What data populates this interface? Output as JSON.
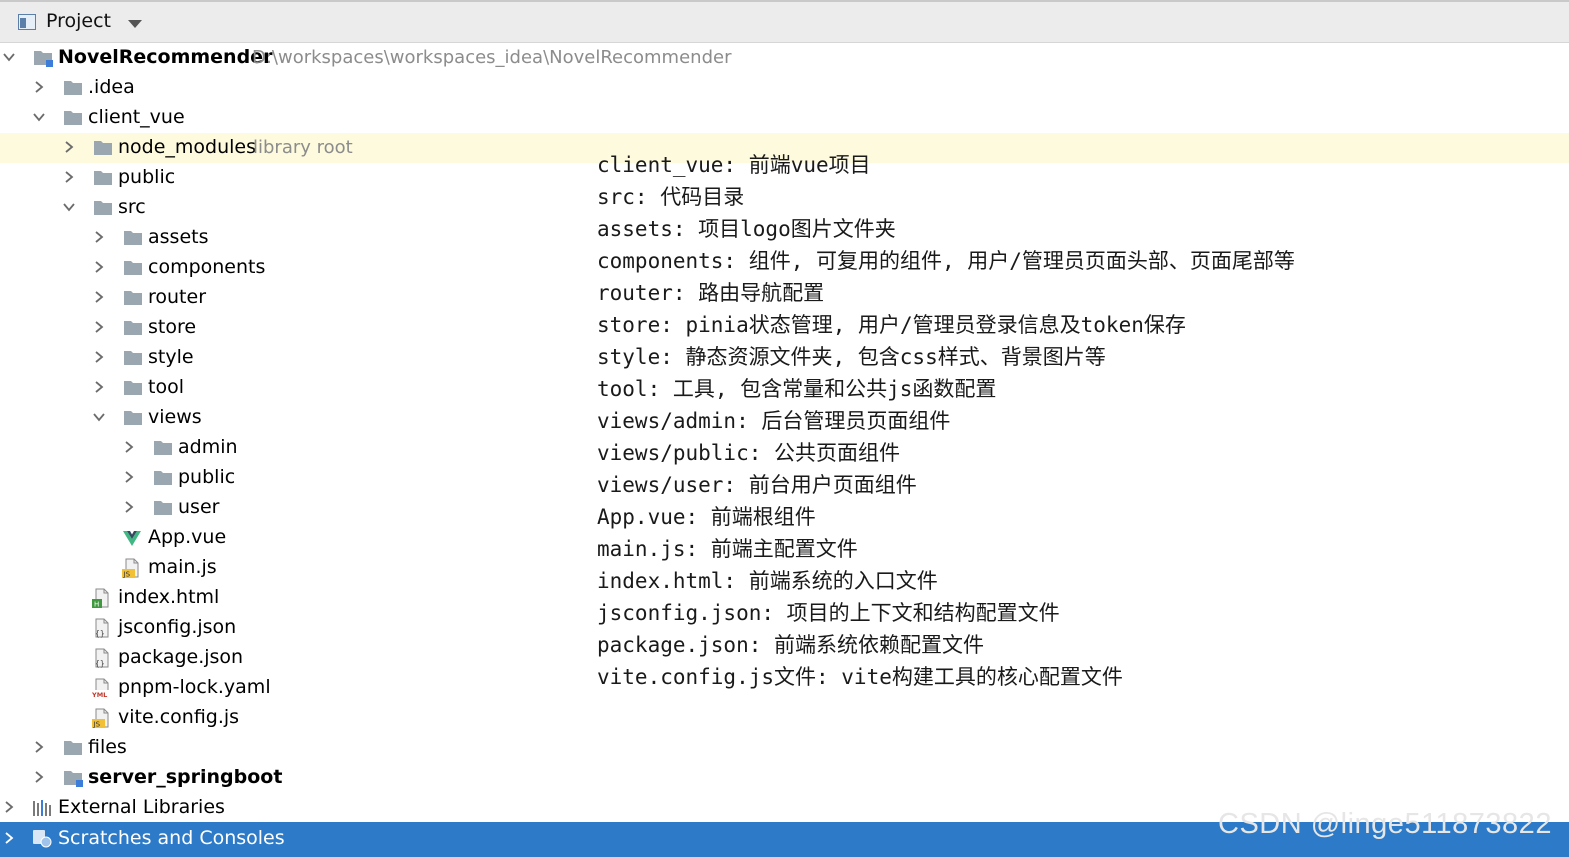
{
  "header": {
    "title": "Project"
  },
  "tree": {
    "root": {
      "label": "NovelRecommender",
      "path": "D:\\workspaces\\workspaces_idea\\NovelRecommender"
    },
    "idea": ".idea",
    "client_vue": "client_vue",
    "node_modules": {
      "label": "node_modules",
      "sub": "library root"
    },
    "public": "public",
    "src": "src",
    "assets": "assets",
    "components": "components",
    "router": "router",
    "store": "store",
    "style": "style",
    "tool": "tool",
    "views": "views",
    "admin": "admin",
    "views_public": "public",
    "user": "user",
    "app_vue": "App.vue",
    "main_js": "main.js",
    "index_html": "index.html",
    "jsconfig": "jsconfig.json",
    "package": "package.json",
    "pnpm": "pnpm-lock.yaml",
    "vite": "vite.config.js",
    "files": "files",
    "server": "server_springboot",
    "external": "External Libraries",
    "scratches": "Scratches and Consoles"
  },
  "notes": [
    "client_vue: 前端vue项目",
    "src: 代码目录",
    "assets: 项目logo图片文件夹",
    "components: 组件, 可复用的组件, 用户/管理员页面头部、页面尾部等",
    "router: 路由导航配置",
    "store: pinia状态管理, 用户/管理员登录信息及token保存",
    "style: 静态资源文件夹, 包含css样式、背景图片等",
    "tool: 工具, 包含常量和公共js函数配置",
    "views/admin: 后台管理员页面组件",
    "views/public: 公共页面组件",
    "views/user: 前台用户页面组件",
    "App.vue: 前端根组件",
    "main.js: 前端主配置文件",
    "index.html: 前端系统的入口文件",
    "jsconfig.json: 项目的上下文和结构配置文件",
    "package.json: 前端系统依赖配置文件",
    "vite.config.js文件: vite构建工具的核心配置文件"
  ],
  "watermark": "CSDN @linge511873822",
  "colors": {
    "selection": "#2c7ac8",
    "highlight": "#fdfadd",
    "folder": "#9aa7b0"
  }
}
